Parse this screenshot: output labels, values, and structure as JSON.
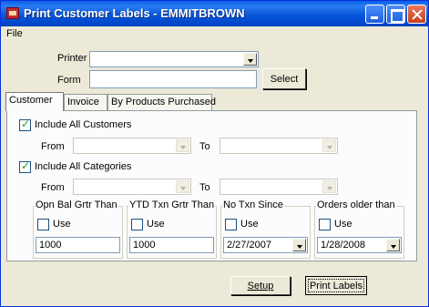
{
  "window": {
    "title": "Print Customer Labels - EMMITBROWN"
  },
  "menu": {
    "file": "File"
  },
  "printer": {
    "label": "Printer",
    "value": ""
  },
  "form": {
    "label": "Form",
    "value": "",
    "select_button": "Select"
  },
  "tabs": [
    {
      "label": "Customer"
    },
    {
      "label": "Invoice"
    },
    {
      "label": "By Products Purchased"
    }
  ],
  "customers": {
    "include_all_label": "Include All Customers",
    "include_all_checked": true,
    "from_label": "From",
    "to_label": "To",
    "from_value": "",
    "to_value": ""
  },
  "categories": {
    "include_all_label": "Include All Categories",
    "include_all_checked": true,
    "from_label": "From",
    "to_label": "To",
    "from_value": "",
    "to_value": ""
  },
  "filters": [
    {
      "title": "Opn Bal Grtr Than",
      "use_label": "Use",
      "use_checked": false,
      "value": "1000"
    },
    {
      "title": "YTD Txn Grtr Than",
      "use_label": "Use",
      "use_checked": false,
      "value": "1000"
    },
    {
      "title": "No Txn Since",
      "use_label": "Use",
      "use_checked": false,
      "value": "2/27/2007"
    },
    {
      "title": "Orders older than",
      "use_label": "Use",
      "use_checked": false,
      "value": "1/28/2008"
    }
  ],
  "buttons": {
    "setup": "Setup",
    "print_labels": "Print Labels"
  },
  "colors": {
    "titlebar": "#0553d8",
    "face": "#ece9d8",
    "check_mark": "#21a121"
  }
}
